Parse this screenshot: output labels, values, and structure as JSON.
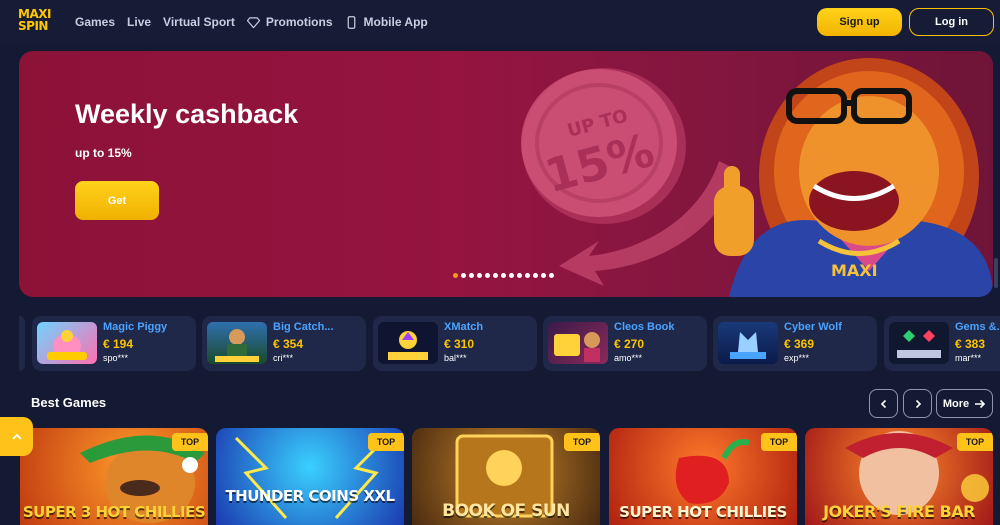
{
  "header": {
    "logo_line1": "MAXI",
    "logo_line2": "SPIN",
    "nav": [
      {
        "label": "Games",
        "icon": ""
      },
      {
        "label": "Live",
        "icon": ""
      },
      {
        "label": "Virtual Sport",
        "icon": ""
      },
      {
        "label": "Promotions",
        "icon": "diamond-icon"
      },
      {
        "label": "Mobile App",
        "icon": "mobile-icon"
      }
    ],
    "signup_label": "Sign up",
    "login_label": "Log in"
  },
  "banner": {
    "title": "Weekly cashback",
    "subtitle": "up to 15%",
    "button_label": "Get",
    "coin_text_top": "UP TO",
    "coin_text_value": "15%",
    "mascot_chain_text": "MAXI",
    "dots_total": 13,
    "active_dot": 1
  },
  "winners": [
    {
      "game": "Magic Piggy",
      "amount": "€ 194",
      "user": "spo***"
    },
    {
      "game": "Big Catch...",
      "amount": "€ 354",
      "user": "cri***"
    },
    {
      "game": "XMatch",
      "amount": "€ 310",
      "user": "bal***"
    },
    {
      "game": "Cleos Book",
      "amount": "€ 270",
      "user": "amo***"
    },
    {
      "game": "Cyber Wolf",
      "amount": "€ 369",
      "user": "exp***"
    },
    {
      "game": "Gems &...",
      "amount": "€ 383",
      "user": "mar***"
    }
  ],
  "best_games": {
    "title": "Best Games",
    "more_label": "More",
    "badge_label": "TOP",
    "games": [
      {
        "title": "SUPER 3 HOT CHILLIES"
      },
      {
        "title": "THUNDER COINS XXL"
      },
      {
        "title": "BOOK OF SUN"
      },
      {
        "title": "SUPER HOT CHILLIES"
      },
      {
        "title": "JOKER'S FIRE BAR"
      }
    ]
  },
  "colors": {
    "accent": "#ffc21a",
    "background": "#141a33",
    "banner": "#8c1238",
    "link_blue": "#4aa3ff"
  }
}
